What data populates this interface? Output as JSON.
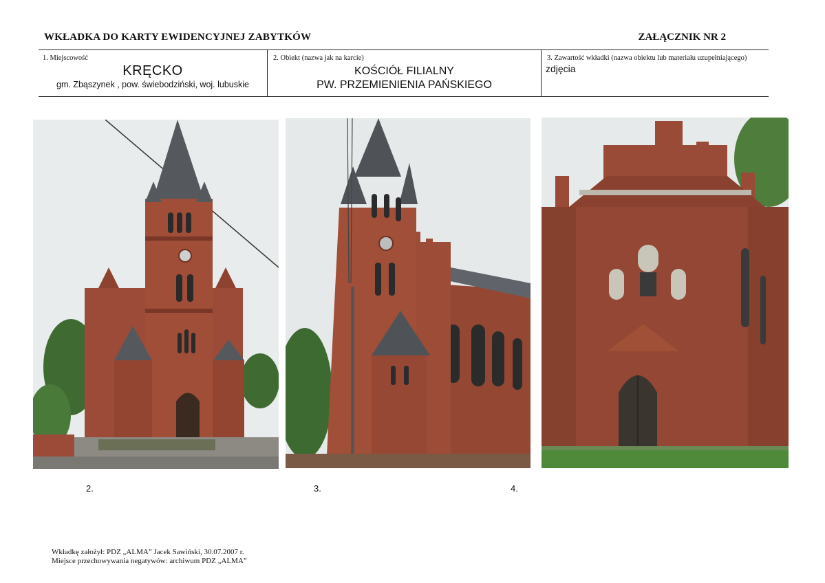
{
  "header": {
    "title": "WKŁADKA DO KARTY EWIDENCYJNEJ ZABYTKÓW",
    "attachment": "ZAŁĄCZNIK NR 2"
  },
  "form": {
    "place": {
      "caption": "1. Miejscowość",
      "name": "KRĘCKO",
      "details": "gm. Zbąszynek , pow. świebodziński, woj. lubuskie"
    },
    "object": {
      "caption": "2. Obiekt (nazwa jak na karcie)",
      "line1": "KOŚCIÓŁ FILIALNY",
      "line2": "PW. PRZEMIENIENIA PAŃSKIEGO"
    },
    "content": {
      "caption": "3. Zawartość wkładki (nazwa obiektu lub materiału uzupełniającego)",
      "value": "zdjęcia"
    }
  },
  "photos": {
    "numbers": [
      "2.",
      "3.",
      "4."
    ],
    "colors": {
      "brick": "#9a4a36",
      "roof": "#4a4d52",
      "sky": "#eceeee",
      "grass": "#4f8a3a"
    }
  },
  "footer": {
    "line1": "Wkładkę założył: PDZ „ALMA” Jacek Sawiński, 30.07.2007 r.",
    "line2": "Miejsce przechowywania negatywów: archiwum PDZ „ALMA”"
  }
}
